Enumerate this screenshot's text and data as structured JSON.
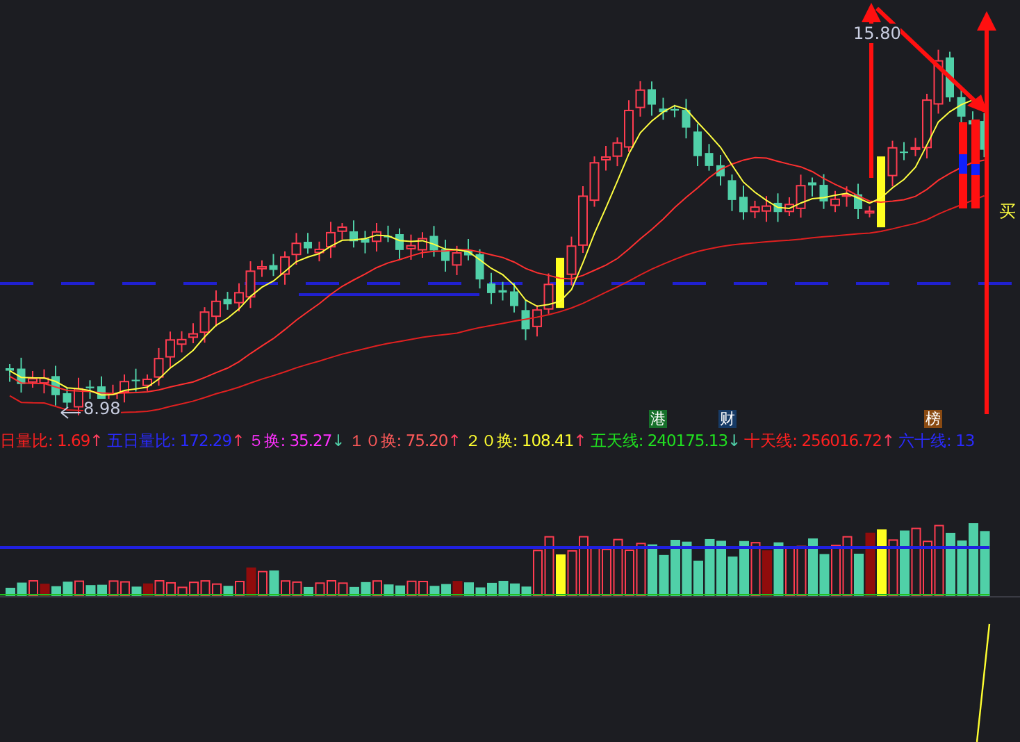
{
  "price_labels": [
    {
      "kind": "low",
      "text": "8.98"
    },
    {
      "kind": "high",
      "text": "15.80"
    },
    {
      "kind": "signal",
      "text": "买"
    }
  ],
  "badges": [
    {
      "text": "港",
      "color": "#16702a"
    },
    {
      "text": "财",
      "color": "#163a66"
    },
    {
      "text": "榜",
      "color": "#8a4a12"
    }
  ],
  "indicators": [
    {
      "label": "日量比:",
      "value": "1.69",
      "arrow": {
        "text": "↑",
        "color": "#ff4060"
      },
      "color": "#ff2020"
    },
    {
      "label": "五日量比:",
      "value": "172.29",
      "arrow": {
        "text": "↑",
        "color": "#ff4060"
      },
      "color": "#2a2aff"
    },
    {
      "label": "５换:",
      "value": "35.27",
      "arrow": {
        "text": "↓",
        "color": "#50d0a8"
      },
      "color": "#ff30ff"
    },
    {
      "label": "１０换:",
      "value": "75.20",
      "arrow": {
        "text": "↑",
        "color": "#ff4060"
      },
      "color": "#ff5a5a"
    },
    {
      "label": "２０换:",
      "value": "108.41",
      "arrow": {
        "text": "↑",
        "color": "#ff4060"
      },
      "color": "#ffff30"
    },
    {
      "label": "五天线:",
      "value": "240175.13",
      "arrow": {
        "text": "↓",
        "color": "#50d0a8"
      },
      "color": "#20e020"
    },
    {
      "label": "十天线:",
      "value": "256016.72",
      "arrow": {
        "text": "↑",
        "color": "#ff4060"
      },
      "color": "#ff2020"
    },
    {
      "label": "六十线:",
      "value": "13",
      "color": "#2a2aff"
    }
  ]
}
